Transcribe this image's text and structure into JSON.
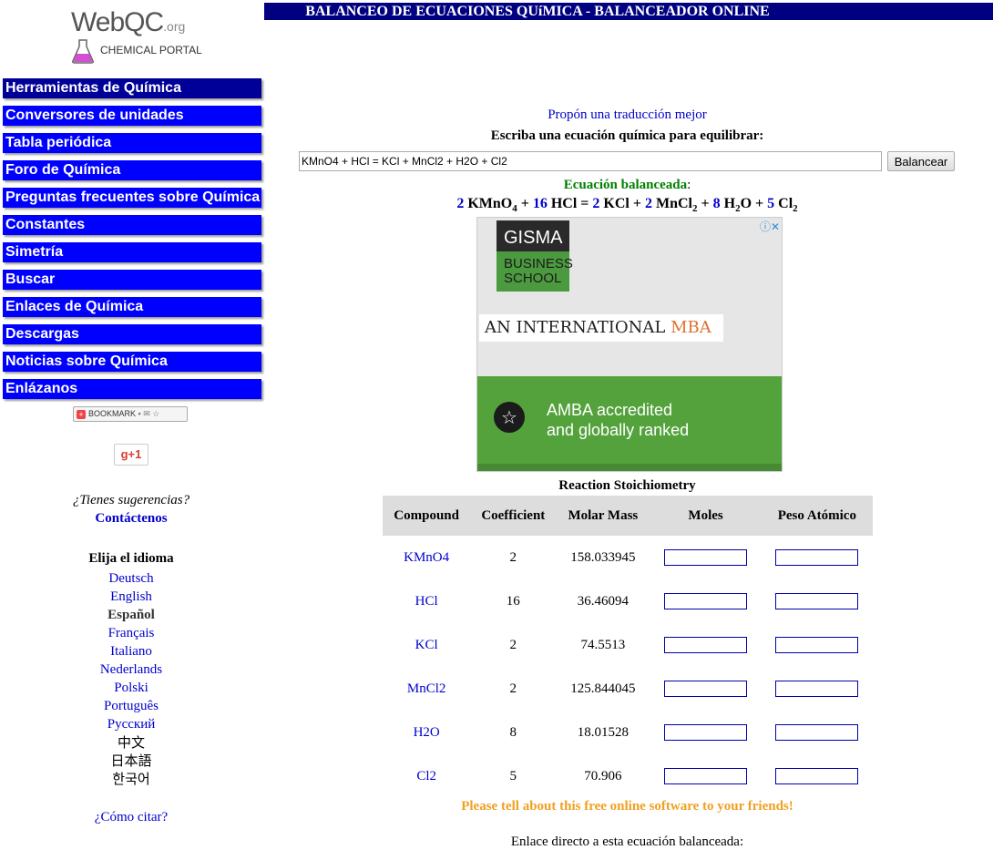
{
  "logo": {
    "wordmark": "WebQC",
    "tld": ".org",
    "tagline": "CHEMICAL PORTAL"
  },
  "menu": [
    "Herramientas de Química",
    "Conversores de unidades",
    "Tabla periódica",
    "Foro de Química",
    "Preguntas frecuentes sobre Química",
    "Constantes",
    "Simetría",
    "Buscar",
    "Enlaces de Química",
    "Descargas",
    "Noticias sobre Química",
    "Enlázanos"
  ],
  "bookmark_label": "BOOKMARK",
  "gplus_label": "g+1",
  "suggestions": {
    "question": "¿Tienes sugerencias?",
    "contact": "Contáctenos"
  },
  "language": {
    "title": "Elija el idioma",
    "options": [
      "Deutsch",
      "English",
      "Español",
      "Français",
      "Italiano",
      "Nederlands",
      "Polski",
      "Português",
      "Русский",
      "中文",
      "日本語",
      "한국어"
    ],
    "selected": "Español"
  },
  "cite": "¿Cómo citar?",
  "header": {
    "title": "BALANCEO DE ECUACIONES QUíMICA - BALANCEADOR ONLINE"
  },
  "propose_translation": "Propón una traducción mejor",
  "prompt": "Escriba una ecuación química para equilibrar:",
  "equation_input": {
    "value": "KMnO4 + HCl = KCl + MnCl2 + H2O + Cl2"
  },
  "balance_button": "Balancear",
  "balanced": {
    "label": "Ecuación balanceada",
    "terms": [
      {
        "coef": "2",
        "formula": "KMnO",
        "sub": "4",
        "op": "+"
      },
      {
        "coef": "16",
        "formula": "HCl",
        "sub": "",
        "op": "="
      },
      {
        "coef": "2",
        "formula": "KCl",
        "sub": "",
        "op": "+"
      },
      {
        "coef": "2",
        "formula": "MnCl",
        "sub": "2",
        "op": "+"
      },
      {
        "coef": "8",
        "formula": "H",
        "sub": "2",
        "tail": "O",
        "op": "+"
      },
      {
        "coef": "5",
        "formula": "Cl",
        "sub": "2",
        "op": ""
      }
    ]
  },
  "ad": {
    "brand_top": "GISMA",
    "brand_bottom_1": "BUSINESS",
    "brand_bottom_2": "SCHOOL",
    "headline_prefix": "AN INTERNATIONAL ",
    "headline_highlight": "MBA",
    "line_1": "AMBA accredited",
    "line_2": "and globally ranked",
    "icons": "ⓘ✕"
  },
  "stoichiometry": {
    "title": "Reaction Stoichiometry",
    "columns": [
      "Compound",
      "Coefficient",
      "Molar Mass",
      "Moles",
      "Peso Atómico"
    ],
    "rows": [
      {
        "compound": "KMnO4",
        "coefficient": "2",
        "molar_mass": "158.033945"
      },
      {
        "compound": "HCl",
        "coefficient": "16",
        "molar_mass": "36.46094"
      },
      {
        "compound": "KCl",
        "coefficient": "2",
        "molar_mass": "74.5513"
      },
      {
        "compound": "MnCl2",
        "coefficient": "2",
        "molar_mass": "125.844045"
      },
      {
        "compound": "H2O",
        "coefficient": "8",
        "molar_mass": "18.01528"
      },
      {
        "compound": "Cl2",
        "coefficient": "5",
        "molar_mass": "70.906"
      }
    ]
  },
  "tell_friends": "Please tell about this free online software to your friends!",
  "direct_link": "Enlace directo a esta ecuación balanceada:"
}
